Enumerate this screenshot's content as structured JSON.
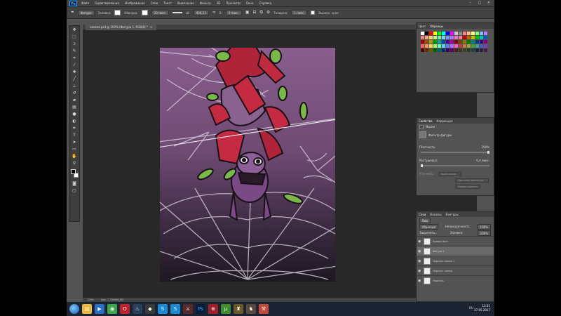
{
  "app": {
    "logo": "Ps"
  },
  "menu": [
    "Файл",
    "Редактирование",
    "Изображение",
    "Слои",
    "Текст",
    "Выделение",
    "Фильтр",
    "3D",
    "Просмотр",
    "Окно",
    "Справка"
  ],
  "window_controls": [
    "–",
    "□",
    "✕"
  ],
  "options_bar": {
    "mode": "Фигура",
    "fill_label": "Заливка:",
    "stroke_label": "Обводка:",
    "stroke_width": "20 пикс.",
    "w_label": "Ш:",
    "w_value": "926,11",
    "h_label": "В:",
    "h_value": "0 пикс.",
    "weight_label": "Толщина:",
    "weight_value": "1 пикс.",
    "align_edges": "Выровн. края"
  },
  "document": {
    "tab_title": "хмммм.psd @ 100% (Фигура 1, RGB/8) *",
    "zoom": "100%",
    "doc_info": "Док: 2,93М/68,8М"
  },
  "tools": [
    "move",
    "marquee",
    "lasso",
    "quick-select",
    "crop",
    "eyedropper",
    "healing",
    "brush",
    "stamp",
    "history-brush",
    "eraser",
    "gradient",
    "blur",
    "dodge",
    "pen",
    "type",
    "path-select",
    "shape",
    "hand",
    "zoom"
  ],
  "swatches_panel": {
    "tabs": [
      "Цвет",
      "Образцы"
    ],
    "colors": [
      "#ffffff",
      "#000000",
      "#ff0000",
      "#ffff00",
      "#00ff00",
      "#00ffff",
      "#0000ff",
      "#ff00ff",
      "#c8c8c8",
      "#8c8c8c",
      "#ff7f7f",
      "#ffbf7f",
      "#ffff7f",
      "#7fff7f",
      "#7fbfff",
      "#bf7fff",
      "#f08080",
      "#f0a878",
      "#f5d878",
      "#c8f078",
      "#78f0a0",
      "#78d8f0",
      "#7898f0",
      "#b078f0",
      "#e078c8",
      "#f07898",
      "#c00000",
      "#c06000",
      "#c0c000",
      "#00c000",
      "#00c0c0",
      "#0060c0",
      "#a00000",
      "#a05000",
      "#a0a000",
      "#00a000",
      "#00a0a0",
      "#0050a0",
      "#5000a0",
      "#a000a0",
      "#800000",
      "#804000",
      "#808000",
      "#008000",
      "#008080",
      "#004080",
      "#400080",
      "#800080",
      "#ff6060",
      "#ff9060",
      "#ffd060",
      "#a0ff60",
      "#60ffc0",
      "#60d0ff",
      "#6080ff",
      "#c060ff",
      "#ff60c0",
      "#c04040",
      "#c08040",
      "#a0a040",
      "#40a040",
      "#40a0a0",
      "#4060c0",
      "#8040c0",
      "#600000",
      "#603000",
      "#606000",
      "#006000",
      "#006060",
      "#003060",
      "#300060",
      "#600060",
      "#402020",
      "#403020",
      "#404020",
      "#204020",
      "#204040",
      "#202040",
      "#302040",
      "#402040"
    ]
  },
  "properties_panel": {
    "tabs": [
      "Свойства",
      "Коррекция"
    ],
    "header": "Маски",
    "mask_label": "Фильтр-фигуры",
    "density_label": "Плотность:",
    "density_value": "100%",
    "feather_label": "Растушевка:",
    "feather_value": "0,0 пикс.",
    "refine_label": "Уточнить:",
    "btn_mask_edge": "Край маски...",
    "btn_color_range": "Цветовой диапазон...",
    "btn_invert": "Инвертировать"
  },
  "layers_panel": {
    "tabs": [
      "Слои",
      "Каналы",
      "Контуры"
    ],
    "filter_kind": "Вид",
    "blend_mode": "Обычные",
    "opacity_label": "Непрозрачность:",
    "opacity_value": "100%",
    "lock_label": "Закрепить:",
    "fill_label": "Заливка:",
    "fill_value": "100%",
    "layers": [
      {
        "name": "Кривая фон",
        "selected": false
      },
      {
        "name": "Фигура 1",
        "selected": true
      },
      {
        "name": "Надпись копия 2",
        "selected": false
      },
      {
        "name": "Надпись копия",
        "selected": false
      },
      {
        "name": "Надпись",
        "selected": false
      }
    ]
  },
  "taskbar": {
    "apps": [
      "explorer",
      "media",
      "chrome",
      "opera",
      "steam",
      "game",
      "skype",
      "skype2",
      "game2",
      "photoshop",
      "antivirus",
      "utorrent",
      "game3",
      "game4",
      "tool"
    ],
    "language": "RU",
    "time": "13:31",
    "date": "27.05.2017"
  }
}
